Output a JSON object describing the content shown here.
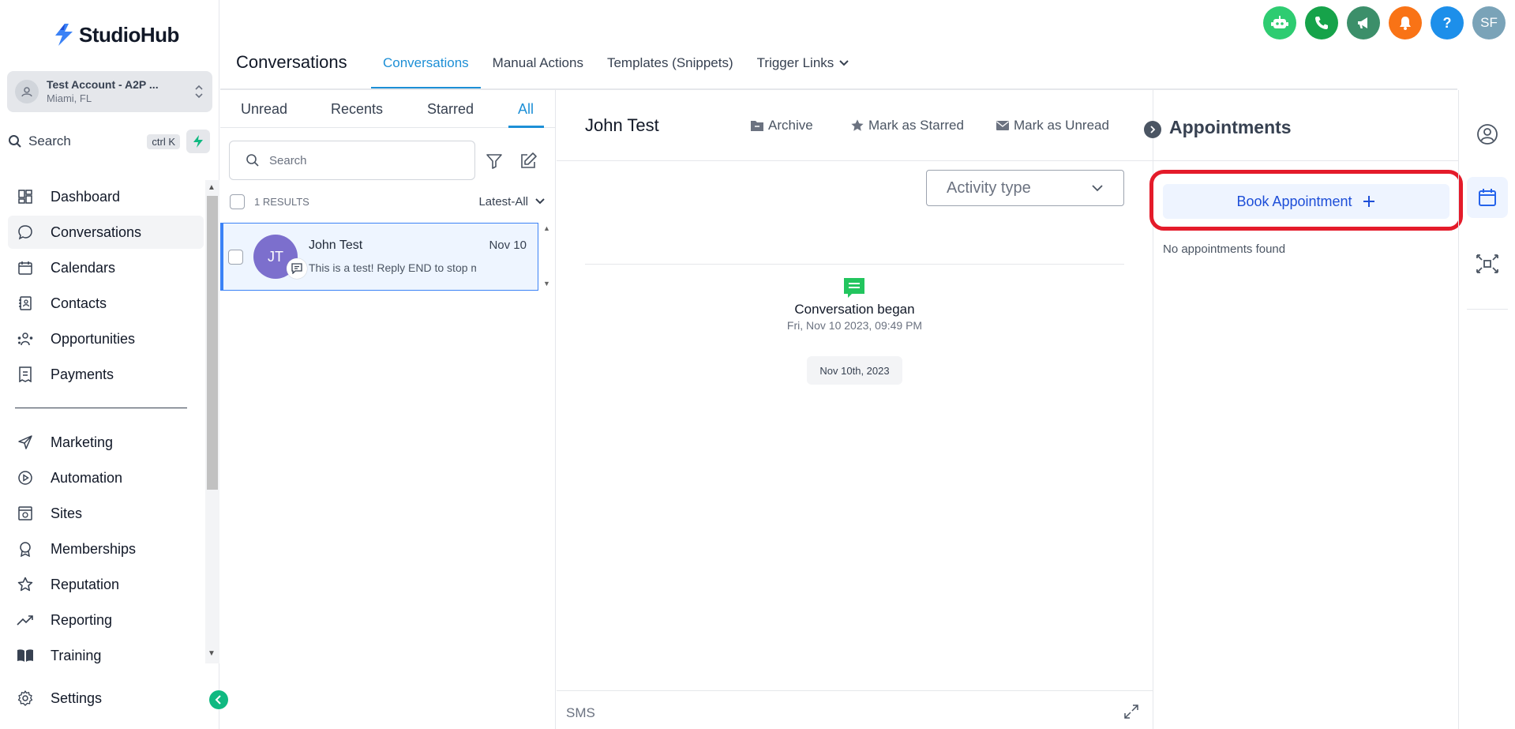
{
  "brand": {
    "name": "StudioHub",
    "accent": "#3b82f6"
  },
  "account": {
    "name": "Test Account - A2P ...",
    "location": "Miami, FL"
  },
  "sidebar_search": {
    "label": "Search",
    "shortcut": "ctrl K"
  },
  "nav": {
    "main": [
      {
        "label": "Dashboard",
        "icon": "dashboard-icon"
      },
      {
        "label": "Conversations",
        "icon": "chat-icon",
        "active": true
      },
      {
        "label": "Calendars",
        "icon": "calendar-icon"
      },
      {
        "label": "Contacts",
        "icon": "contacts-icon"
      },
      {
        "label": "Opportunities",
        "icon": "opportunities-icon"
      },
      {
        "label": "Payments",
        "icon": "payments-icon"
      }
    ],
    "secondary": [
      {
        "label": "Marketing",
        "icon": "send-icon"
      },
      {
        "label": "Automation",
        "icon": "automation-icon"
      },
      {
        "label": "Sites",
        "icon": "sites-icon"
      },
      {
        "label": "Memberships",
        "icon": "award-icon"
      },
      {
        "label": "Reputation",
        "icon": "star-icon"
      },
      {
        "label": "Reporting",
        "icon": "trend-icon"
      },
      {
        "label": "Training",
        "icon": "book-icon"
      }
    ],
    "settings": {
      "label": "Settings",
      "icon": "gear-icon"
    }
  },
  "header": {
    "title": "Conversations",
    "tabs": [
      {
        "label": "Conversations",
        "active": true
      },
      {
        "label": "Manual Actions"
      },
      {
        "label": "Templates (Snippets)"
      },
      {
        "label": "Trigger Links",
        "dropdown": true
      }
    ],
    "avatar_initials": "SF",
    "help_label": "?"
  },
  "conv_list": {
    "filter_tabs": [
      "Unread",
      "Recents",
      "Starred",
      "All"
    ],
    "active_filter": "All",
    "search_placeholder": "Search",
    "results_label": "1 RESULTS",
    "sort_label": "Latest-All",
    "items": [
      {
        "initials": "JT",
        "name": "John Test",
        "date": "Nov 10",
        "preview": "This is a test! Reply END to stop m",
        "channel": "sms"
      }
    ]
  },
  "chat": {
    "contact_name": "John Test",
    "actions": {
      "archive": "Archive",
      "star": "Mark as Starred",
      "unread": "Mark as Unread"
    },
    "activity_placeholder": "Activity type",
    "event_title": "Conversation began",
    "event_time": "Fri, Nov 10 2023, 09:49 PM",
    "date_chip": "Nov 10th, 2023",
    "compose_channel": "SMS"
  },
  "appointments": {
    "title": "Appointments",
    "book_label": "Book Appointment",
    "empty_text": "No appointments found",
    "highlight_color": "#e41b2a"
  },
  "colors": {
    "bot": "#2ecc71",
    "phone": "#16a34a",
    "announce": "#3c8f6a",
    "bell": "#f97316",
    "help": "#1d8fea",
    "avatar": "#7aa3b8",
    "green_accent": "#10b981"
  }
}
